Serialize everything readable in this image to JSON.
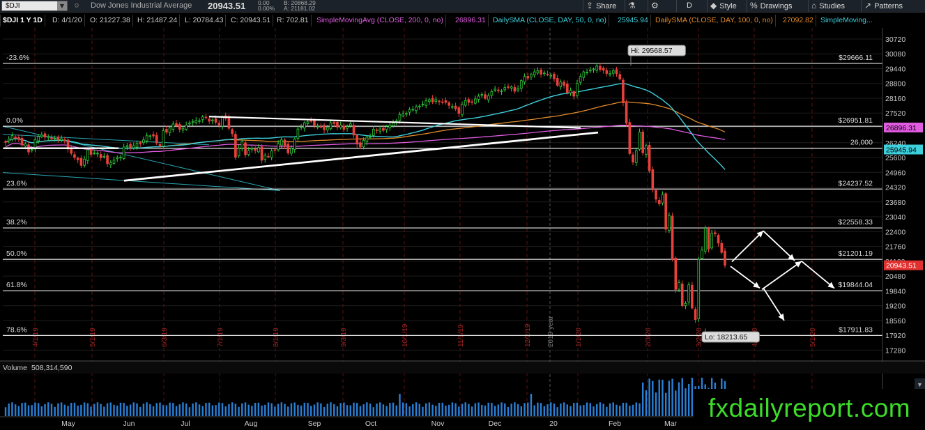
{
  "toolbar": {
    "symbol": "$DJI",
    "name": "Dow Jones Industrial Average",
    "last": "20943.51",
    "change_abs": "0.00",
    "change_pct": "0.00%",
    "bid": "B: 20868.29",
    "ask": "A: 21181.02",
    "buttons": [
      {
        "label": "Share",
        "icon": "share-icon",
        "glyph": "⇪"
      },
      {
        "label": "",
        "icon": "flask-icon",
        "glyph": "⚗"
      },
      {
        "label": "",
        "icon": "gear-icon",
        "glyph": "⚙"
      },
      {
        "label": "D",
        "icon": "",
        "glyph": ""
      },
      {
        "label": "Style",
        "icon": "style-icon",
        "glyph": "◆"
      },
      {
        "label": "Drawings",
        "icon": "drawings-icon",
        "glyph": "%"
      },
      {
        "label": "Studies",
        "icon": "studies-icon",
        "glyph": "⌂"
      },
      {
        "label": "Patterns",
        "icon": "patterns-icon",
        "glyph": "↗"
      }
    ]
  },
  "infobar": {
    "title": "$DJI 1 Y 1D",
    "date": "D: 4/1/20",
    "open": "O: 21227.38",
    "high": "H: 21487.24",
    "low": "L: 20784.43",
    "close": "C: 20943.51",
    "range": "R: 702.81",
    "studies": [
      {
        "name": "SimpleMovingAvg (CLOSE, 200, 0, no)",
        "value": "26896.31",
        "color": "#e05be0"
      },
      {
        "name": "DailySMA (CLOSE, DAY, 50, 0, no)",
        "value": "25945.94",
        "color": "#3ccfdc"
      },
      {
        "name": "DailySMA (CLOSE, DAY, 100, 0, no)",
        "value": "27092.82",
        "color": "#e08a2a"
      },
      {
        "name": "SimpleMoving...",
        "value": "",
        "color": "#3ccfdc"
      }
    ]
  },
  "volume": {
    "label": "Volume",
    "value": "508,314,590"
  },
  "watermark": "fxdailyreport.com",
  "chart_data": {
    "type": "candlestick",
    "y_ticks": [
      30720,
      30080,
      29440,
      28800,
      28160,
      27520,
      26880,
      26240,
      25600,
      24960,
      24320,
      23680,
      23040,
      22400,
      21760,
      21120,
      20480,
      19840,
      19200,
      18560,
      17920,
      17280
    ],
    "ylim": [
      16900,
      31200
    ],
    "x_months": [
      "May",
      "Jun",
      "Jul",
      "Aug",
      "Sep",
      "Oct",
      "Nov",
      "Dec",
      "20",
      "Feb",
      "Mar"
    ],
    "x_dates": [
      "4/1/19",
      "5/1/19",
      "6/3/19",
      "7/1/19",
      "8/1/19",
      "9/3/19",
      "10/1/19",
      "11/1/19",
      "12/2/19",
      "1/1/20",
      "2/3/20",
      "3/2/20",
      "4/1/20",
      "5/1/20"
    ],
    "year_marker": "2019 year",
    "fib_levels": [
      {
        "pct": "-23.6%",
        "price": 29666.11,
        "label": "$29666.11"
      },
      {
        "pct": "0.0%",
        "price": 26951.81,
        "label": "$26951.81"
      },
      {
        "pct": "",
        "price": 26000,
        "label": "26,000"
      },
      {
        "pct": "23.6%",
        "price": 24237.52,
        "label": "$24237.52"
      },
      {
        "pct": "38.2%",
        "price": 22558.33,
        "label": "$22558.33"
      },
      {
        "pct": "50.0%",
        "price": 21201.19,
        "label": "$21201.19"
      },
      {
        "pct": "61.8%",
        "price": 19844.04,
        "label": "$19844.04"
      },
      {
        "pct": "78.6%",
        "price": 17911.83,
        "label": "$17911.83"
      }
    ],
    "price_tags": [
      {
        "price": 26896.31,
        "label": "26896.31",
        "color": "#e05be0"
      },
      {
        "price": 25945.94,
        "label": "25945.94",
        "color": "#3ccfdc"
      },
      {
        "price": 20943.51,
        "label": "20943.51",
        "color": "#e03030"
      }
    ],
    "hi_label": "Hi: 29568.57",
    "lo_label": "Lo: 18213.65",
    "hi_price": 29568.57,
    "lo_price": 18213.65,
    "closes": [
      26258,
      26394,
      26543,
      26432,
      26385,
      26143,
      26188,
      25838,
      25942,
      26380,
      26508,
      26567,
      26478,
      26506,
      26397,
      26430,
      26380,
      26410,
      26312,
      25966,
      25780,
      25598,
      25500,
      25260,
      25532,
      25930,
      25735,
      25799,
      25786,
      25585,
      25650,
      25332,
      25370,
      25490,
      25585,
      25617,
      26052,
      26111,
      26040,
      26105,
      26214,
      26195,
      26360,
      26540,
      26537,
      26530,
      26230,
      26100,
      26760,
      26690,
      26880,
      27050,
      26980,
      26820,
      26860,
      27000,
      27090,
      27160,
      27200,
      27188,
      27350,
      27320,
      27169,
      27223,
      27120,
      27000,
      27360,
      27290,
      26864,
      26630,
      25610,
      26000,
      26300,
      25720,
      25900,
      26000,
      25897,
      26030,
      25480,
      25700,
      25640,
      25880,
      25920,
      26200,
      26360,
      26120,
      25800,
      26000,
      26400,
      26830,
      26910,
      27100,
      27140,
      27180,
      27000,
      26950,
      26935,
      26800,
      26900,
      27100,
      27070,
      26920,
      27000,
      26820,
      26940,
      27050,
      26570,
      26180,
      26060,
      26340,
      26480,
      26500,
      26820,
      26790,
      26830,
      26770,
      26930,
      27000,
      27090,
      27180,
      27460,
      27480,
      27500,
      27670,
      27680,
      27780,
      27820,
      27900,
      28050,
      28100,
      28000,
      28100,
      28010,
      28000,
      27980,
      27850,
      27800,
      27700,
      27500,
      27900,
      28060,
      27980,
      28000,
      28130,
      28250,
      28320,
      28150,
      28270,
      28450,
      28550,
      28500,
      28480,
      28620,
      28650,
      28650,
      28460,
      28580,
      28920,
      29100,
      29030,
      29190,
      29300,
      29350,
      29200,
      29250,
      29180,
      29150,
      29000,
      28720,
      28860,
      28720,
      28400,
      28500,
      28250,
      28800,
      29100,
      29300,
      29290,
      29380,
      29420,
      29550,
      29400,
      29370,
      29230,
      29220,
      29350,
      29220,
      28990,
      27960,
      27080,
      25770,
      25400,
      25900,
      26700,
      25800,
      26120,
      25020,
      24200,
      23800,
      23600,
      24000,
      22500,
      23100,
      21200,
      19900,
      20200,
      19200,
      19300,
      20100,
      19100,
      18600,
      21200,
      21600,
      22550,
      21640,
      22330,
      22300,
      21900,
      21500,
      20943
    ]
  }
}
